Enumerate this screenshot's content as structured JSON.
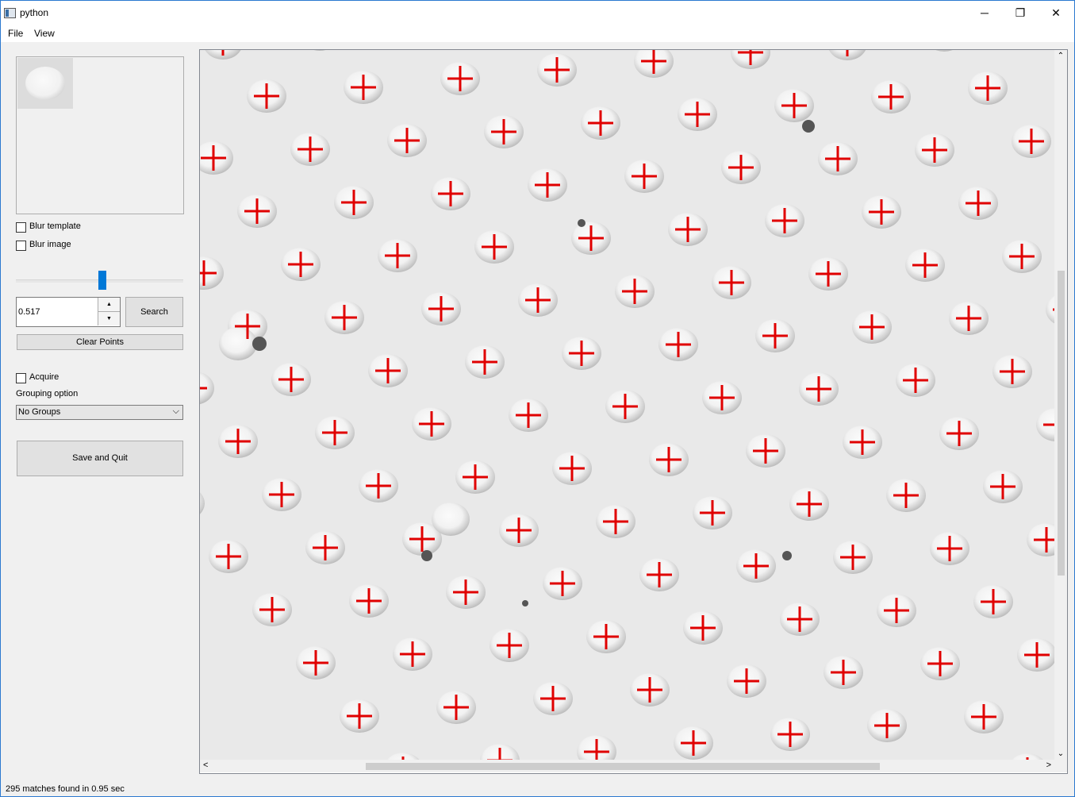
{
  "window": {
    "title": "python",
    "icon": "app-window-icon",
    "controls": {
      "minimize": "─",
      "restore": "❐",
      "close": "✕"
    }
  },
  "menu": [
    "File",
    "View"
  ],
  "left_panel": {
    "template_preview": {
      "icon": "template-thumbnail"
    },
    "blur_template": {
      "label": "Blur template",
      "checked": false
    },
    "blur_image": {
      "label": "Blur image",
      "checked": false
    },
    "threshold": {
      "value": "0.517",
      "up": "▲",
      "down": "▼"
    },
    "search_label": "Search",
    "clear_label": "Clear Points",
    "acquire": {
      "label": "Acquire",
      "checked": false
    },
    "grouping_label": "Grouping option",
    "grouping_value": "No Groups",
    "grouping_chevron": "⌵",
    "save_label": "Save and Quit"
  },
  "viewer": {
    "marker_color": "#e00000",
    "scroll": {
      "up": "⌃",
      "down": "⌄",
      "left": "<",
      "right": ">"
    }
  },
  "status": {
    "text": "295 matches found in 0.95 sec"
  }
}
